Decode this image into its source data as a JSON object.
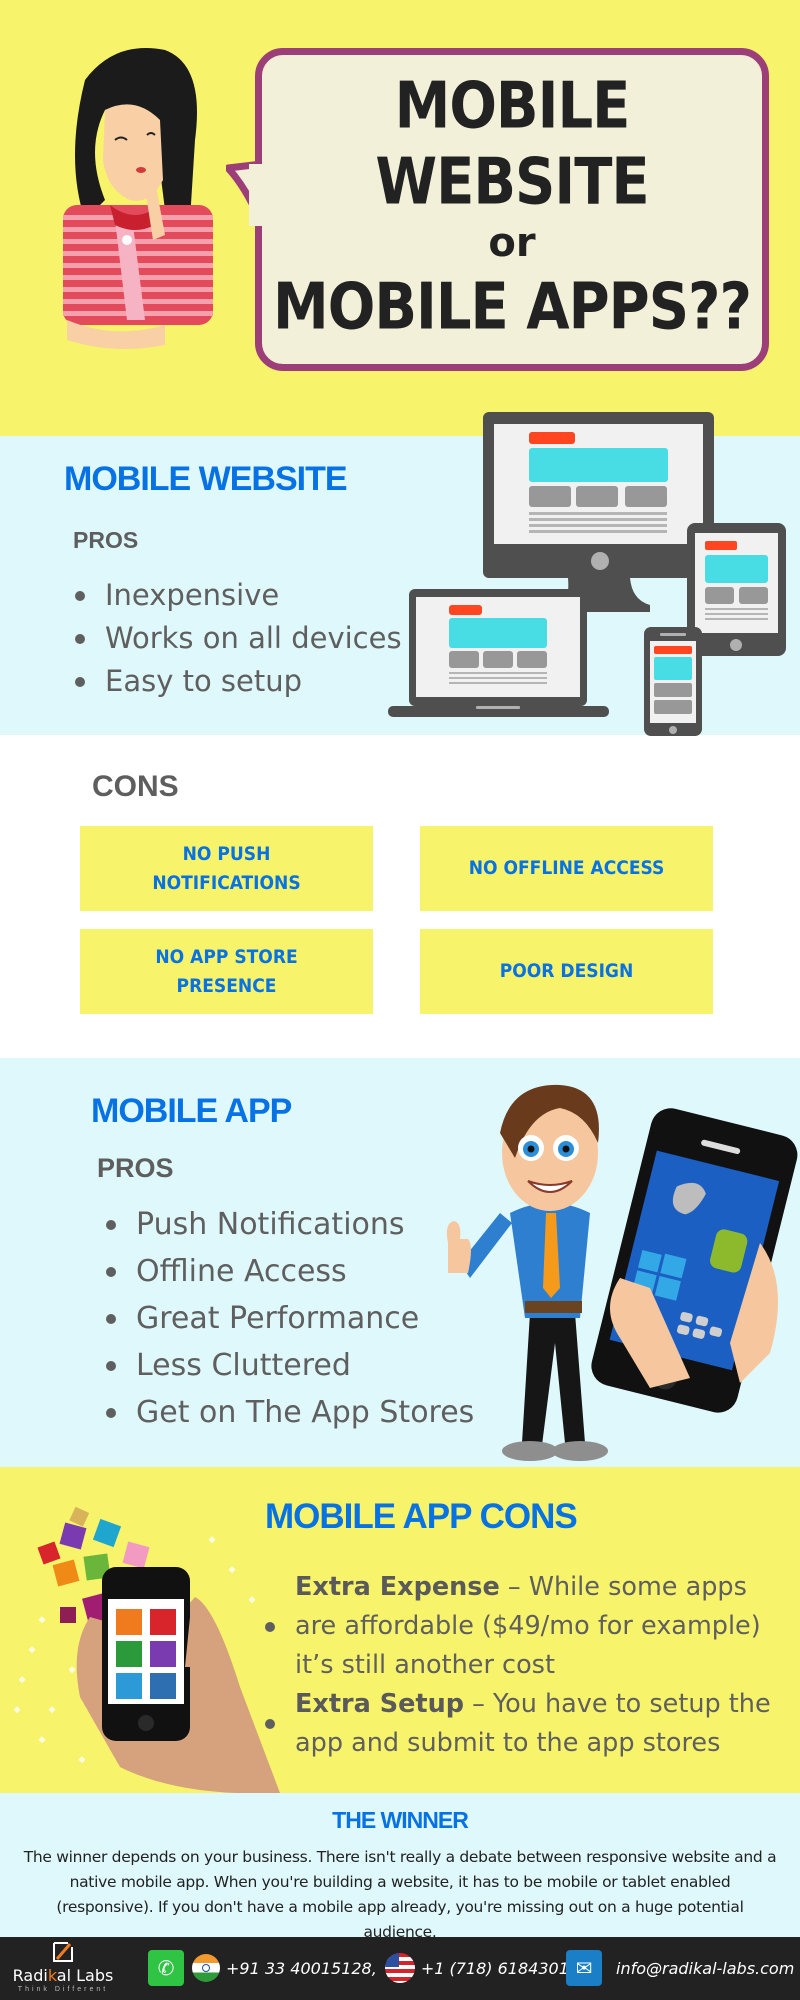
{
  "hero": {
    "title_line1": "MOBILE WEBSITE",
    "title_or": "or",
    "title_line2": "MOBILE APPS??",
    "illustration": "thinking-girl",
    "colors": {
      "background": "#f7f36b",
      "bubble_border": "#9c3f78",
      "bubble_fill": "#f2f0d9"
    }
  },
  "mobile_website": {
    "heading": "MOBILE WEBSITE",
    "pros_label": "PROS",
    "pros": [
      "Inexpensive",
      "Works on all devices",
      "Easy to setup"
    ],
    "illustration": "responsive-devices"
  },
  "website_cons": {
    "heading": "CONS",
    "items": [
      "NO PUSH NOTIFICATIONS",
      "NO OFFLINE ACCESS",
      "NO APP STORE PRESENCE",
      "POOR DESIGN"
    ]
  },
  "mobile_app": {
    "heading": "MOBILE APP",
    "pros_label": "PROS",
    "pros": [
      "Push Notifications",
      "Offline Access",
      "Great Performance",
      "Less Cluttered",
      "Get on The App Stores"
    ],
    "illustration": "man-holding-phone",
    "phone_icons": [
      "apple-icon",
      "android-icon",
      "windows-icon",
      "blackberry-icon"
    ]
  },
  "app_cons": {
    "heading": "MOBILE APP CONS",
    "items": [
      {
        "bold": "Extra Expense",
        "text": " – While some apps are affordable ($49/mo for example) it’s still another cost"
      },
      {
        "bold": "Extra Setup",
        "text": " – You have to setup the app and submit to the app stores"
      }
    ],
    "illustration": "hand-holding-phone-with-apps"
  },
  "winner": {
    "heading": "THE WINNER",
    "body": "The winner depends on your business. There isn't really a debate between responsive website and a native mobile app. When you're building a website, it has to be mobile or tablet enabled (responsive). If you don't have a mobile app already, you're missing out on a huge potential audience."
  },
  "footer": {
    "brand_pre": "Radi",
    "brand_k": "k",
    "brand_post": "al Labs",
    "tagline": "Think Different",
    "phone_india": "+91 33 40015128,",
    "phone_us": "+1 (718) 6184301",
    "email": "info@radikal-labs.com",
    "colors": {
      "accent": "#f07a1f",
      "phone_icon": "#2fc444",
      "mail_icon": "#1a7fc6"
    }
  },
  "colors": {
    "blue_heading": "#0672e4",
    "gray_text": "#5f5f5f",
    "light_blue_bg": "#dff8fc",
    "yellow_bg": "#f7f36b"
  }
}
